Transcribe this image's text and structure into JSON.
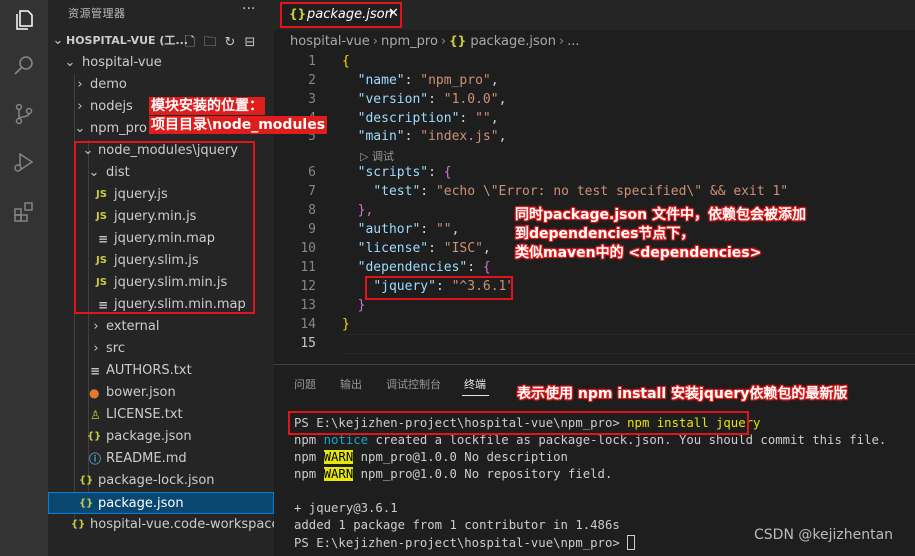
{
  "explorer": {
    "title": "资源管理器",
    "more": "···",
    "workspace": "HOSPITAL-VUE (工...",
    "tree": [
      {
        "label": "hospital-vue",
        "type": "folder-open"
      },
      {
        "label": "demo",
        "type": "folder"
      },
      {
        "label": "nodejs",
        "type": "folder"
      },
      {
        "label": "npm_pro",
        "type": "folder-open"
      },
      {
        "label": "node_modules\\jquery",
        "type": "folder-open"
      },
      {
        "label": "dist",
        "type": "folder-open"
      },
      {
        "label": "jquery.js",
        "type": "js"
      },
      {
        "label": "jquery.min.js",
        "type": "js"
      },
      {
        "label": "jquery.min.map",
        "type": "map"
      },
      {
        "label": "jquery.slim.js",
        "type": "js"
      },
      {
        "label": "jquery.slim.min.js",
        "type": "js"
      },
      {
        "label": "jquery.slim.min.map",
        "type": "map"
      },
      {
        "label": "external",
        "type": "folder"
      },
      {
        "label": "src",
        "type": "folder"
      },
      {
        "label": "AUTHORS.txt",
        "type": "txt"
      },
      {
        "label": "bower.json",
        "type": "bower"
      },
      {
        "label": "LICENSE.txt",
        "type": "license"
      },
      {
        "label": "package.json",
        "type": "json"
      },
      {
        "label": "README.md",
        "type": "md"
      },
      {
        "label": "package-lock.json",
        "type": "json"
      },
      {
        "label": "package.json",
        "type": "json",
        "selected": true
      },
      {
        "label": "hospital-vue.code-workspace",
        "type": "json"
      }
    ]
  },
  "editor": {
    "tab_label": "package.json",
    "tab_close": "✕",
    "breadcrumb": [
      "hospital-vue",
      "npm_pro",
      "package.json",
      "..."
    ],
    "codelens": "▷ 调试",
    "line_numbers": [
      "1",
      "2",
      "3",
      "4",
      "5",
      "6",
      "7",
      "8",
      "9",
      "10",
      "11",
      "12",
      "13",
      "14",
      "15"
    ],
    "code": {
      "l1": "{",
      "l2k": "\"name\"",
      "l2v": "\"npm_pro\"",
      "l3k": "\"version\"",
      "l3v": "\"1.0.0\"",
      "l4k": "\"description\"",
      "l4v": "\"\"",
      "l5k": "\"main\"",
      "l5v": "\"index.js\"",
      "l6k": "\"scripts\"",
      "l7k": "\"test\"",
      "l7v": "\"echo \\\"Error: no test specified\\\" && exit 1\"",
      "l8": "},",
      "l9k": "\"author\"",
      "l9v": "\"\"",
      "l10k": "\"license\"",
      "l10v": "\"ISC\"",
      "l11k": "\"dependencies\"",
      "l12k": "\"jquery\"",
      "l12v": "\"^3.6.1\"",
      "l13": "}",
      "l14": "}"
    }
  },
  "panel": {
    "tabs": [
      "问题",
      "输出",
      "调试控制台",
      "终端"
    ],
    "active_tab": "终端",
    "terminal": {
      "prompt1": "PS E:\\kejizhen-project\\hospital-vue\\npm_pro> ",
      "command": "npm install jquery",
      "l2_npm": "npm ",
      "l2_notice": "notice",
      "l2_rest": " created a lockfile as package-lock.json. You should commit this file.",
      "l3_npm": "npm ",
      "l3_warn": "WARN",
      "l3_rest": " npm_pro@1.0.0 No description",
      "l4_npm": "npm ",
      "l4_warn": "WARN",
      "l4_rest": " npm_pro@1.0.0 No repository field.",
      "l5": "+ jquery@3.6.1",
      "l6": "added 1 package from 1 contributor in 1.486s",
      "prompt2": "PS E:\\kejizhen-project\\hospital-vue\\npm_pro> "
    }
  },
  "annotations": {
    "module_location_1": "模块安装的位置：",
    "module_location_2": "项目目录\\node_modules",
    "deps_1": "同时package.json 文件中，依赖包会被添加",
    "deps_2": "到dependencies节点下，",
    "deps_3": "类似maven中的 <dependencies>",
    "install_note": "表示使用 npm install 安装jquery依赖包的最新版"
  },
  "watermark": "CSDN @kejizhentan",
  "colors": {
    "annotation_red": "#e0151b",
    "accent_blue": "#007fd4",
    "json_key": "#9cdcfe",
    "json_string": "#ce9178"
  }
}
